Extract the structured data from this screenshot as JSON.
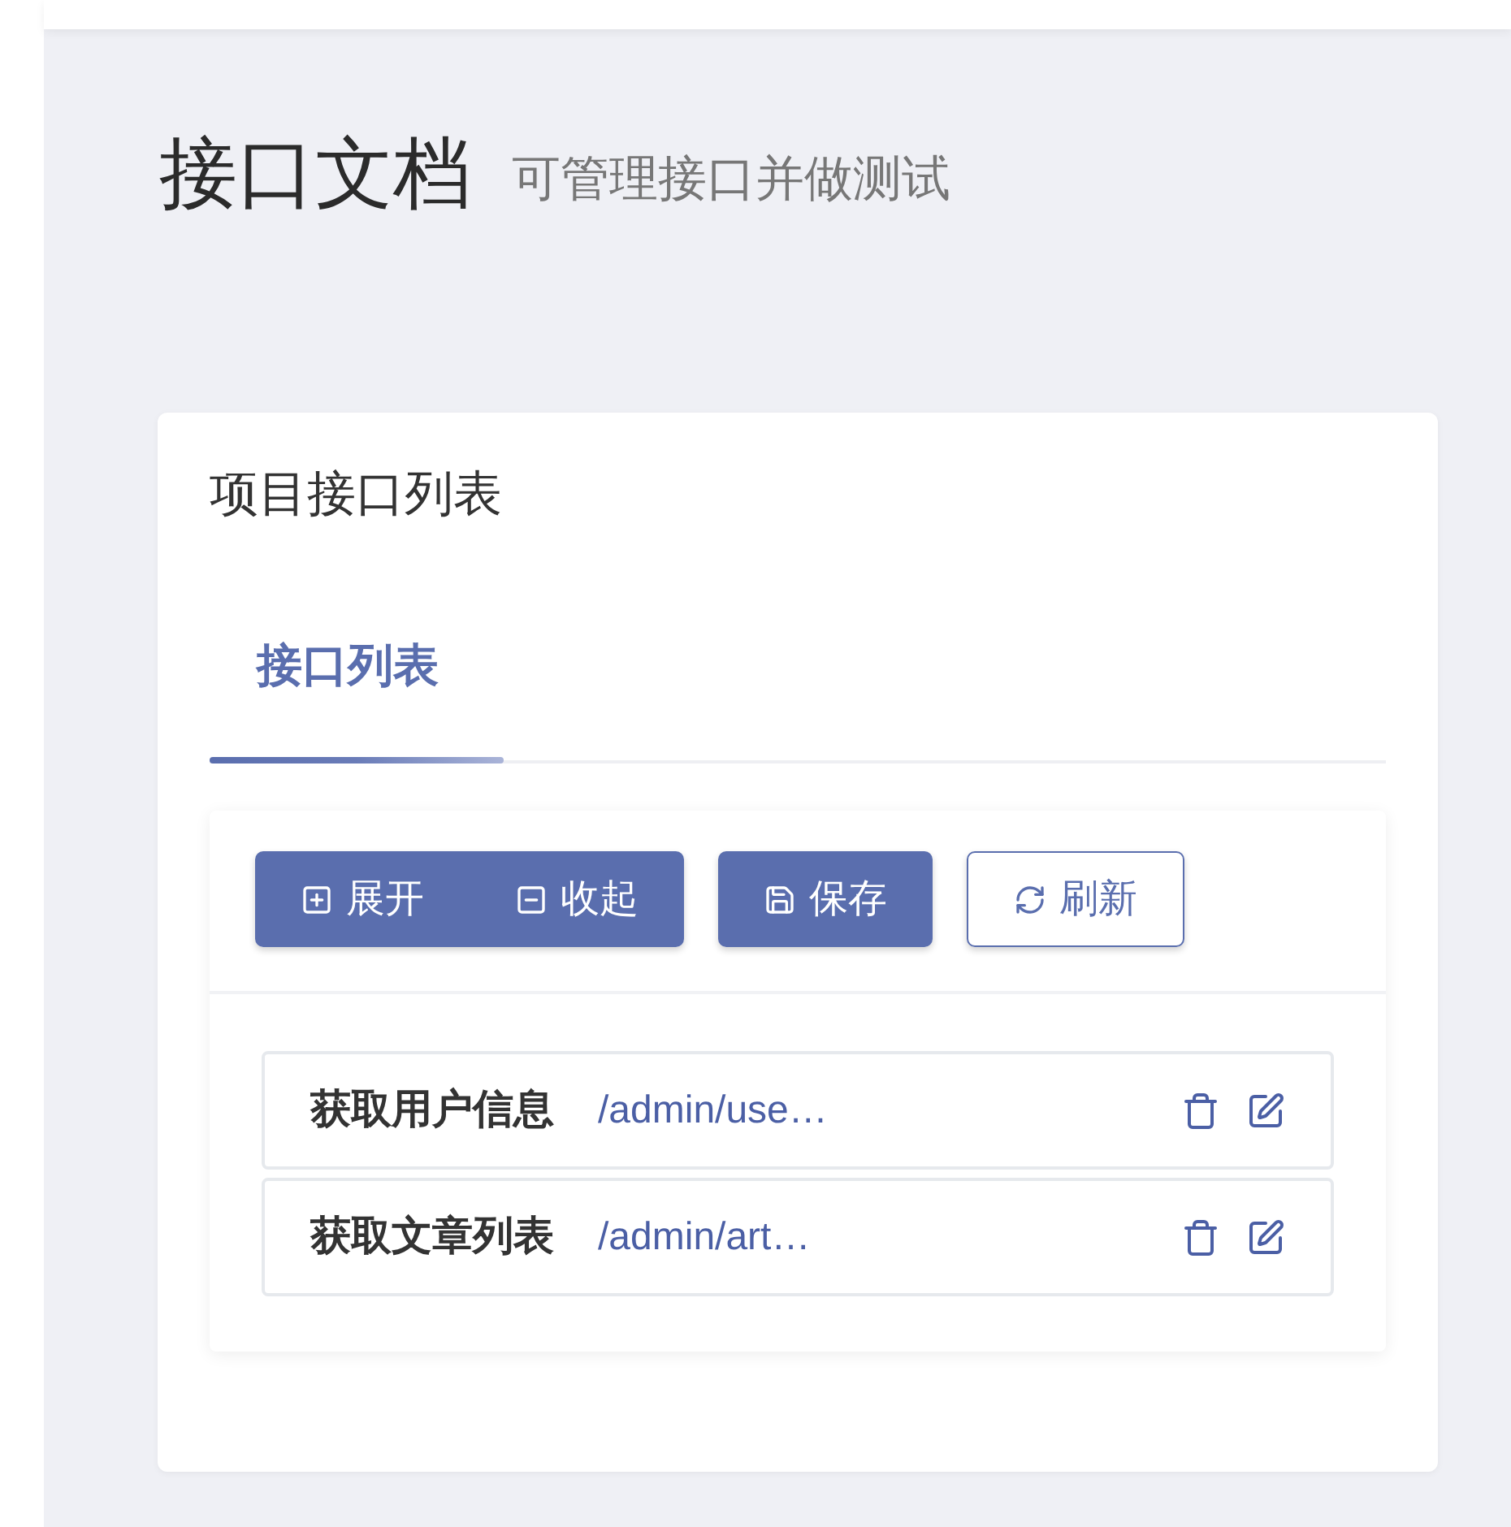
{
  "header": {
    "title": "接口文档",
    "subtitle": "可管理接口并做测试"
  },
  "card": {
    "title": "项目接口列表",
    "tabs": [
      {
        "label": "接口列表",
        "selected": true
      }
    ]
  },
  "toolbar": {
    "groups": [
      {
        "buttons": [
          {
            "kind": "expand",
            "label": "展开"
          },
          {
            "kind": "collapse",
            "label": "收起"
          }
        ]
      },
      {
        "buttons": [
          {
            "kind": "save",
            "label": "保存"
          }
        ]
      },
      {
        "buttons": [
          {
            "kind": "refresh",
            "label": "刷新"
          }
        ]
      }
    ]
  },
  "endpoints": [
    {
      "name": "获取用户信息",
      "path": "/admin/use…"
    },
    {
      "name": "获取文章列表",
      "path": "/admin/art…"
    }
  ]
}
